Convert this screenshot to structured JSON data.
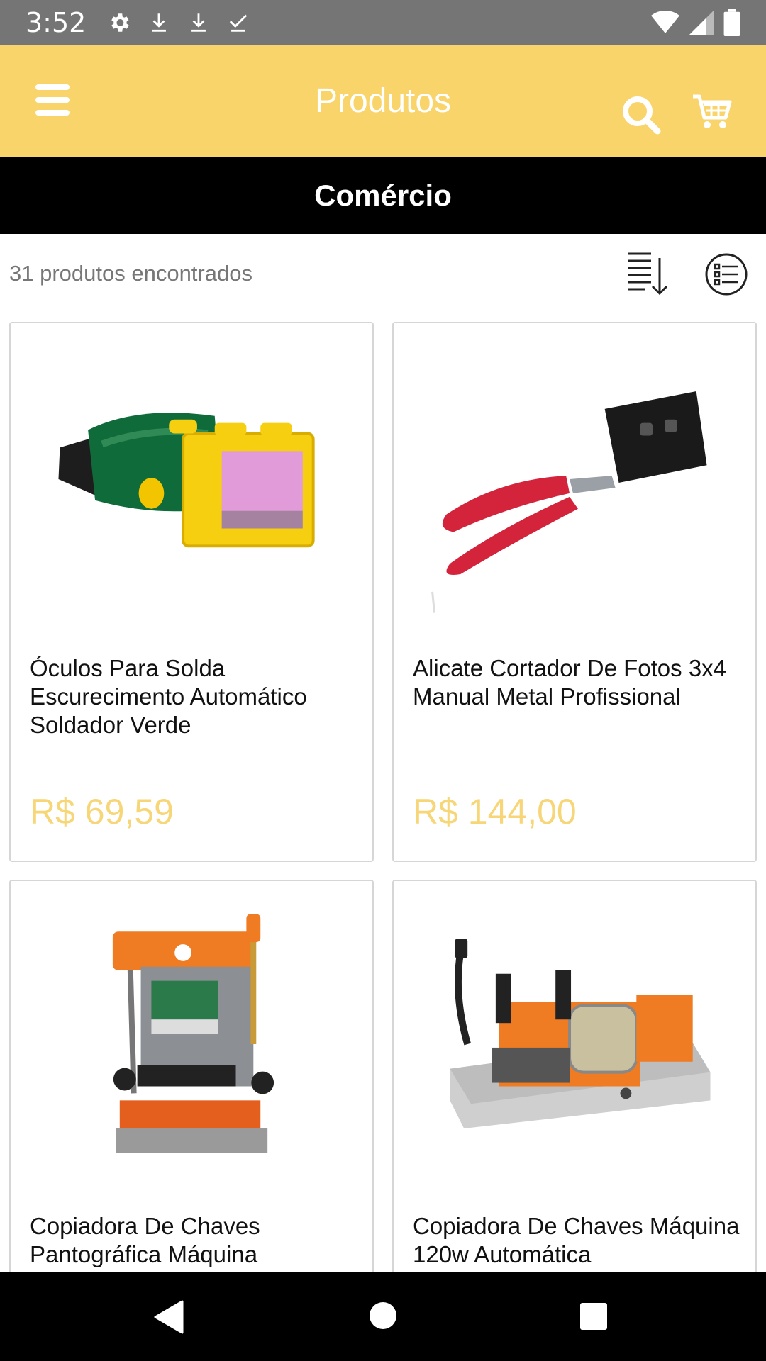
{
  "status_bar": {
    "time": "3:52",
    "left_icons": [
      "settings-icon",
      "download-icon",
      "download-icon",
      "download-done-icon"
    ],
    "right_icons": [
      "wifi-icon",
      "signal-icon",
      "battery-icon"
    ]
  },
  "app_bar": {
    "title": "Produtos",
    "background": "#f8d46a",
    "icons": [
      "menu-icon",
      "search-icon",
      "cart-icon"
    ]
  },
  "category": {
    "label": "Comércio"
  },
  "results": {
    "count_text": "31 produtos encontrados",
    "icons": [
      "sort-icon",
      "list-view-icon"
    ]
  },
  "products": [
    {
      "name": "Óculos Para Solda Escurecimento Automático Soldador Verde",
      "price": "R$ 69,59",
      "image": "welding-goggles-image"
    },
    {
      "name": "Alicate Cortador De Fotos 3x4 Manual Metal Profissional",
      "price": "R$ 144,00",
      "image": "photo-cutter-pliers-image"
    },
    {
      "name": "Copiadora De Chaves Pantográfica Máquina",
      "price": "",
      "image": "key-cutting-machine-image"
    },
    {
      "name": "Copiadora De Chaves Máquina 120w Automática",
      "price": "",
      "image": "key-copier-machine-image"
    }
  ],
  "colors": {
    "accent": "#f8d46a",
    "price": "#f7d678",
    "status_bar": "#757575"
  },
  "nav_bar": {
    "icons": [
      "back-icon",
      "home-icon",
      "recents-icon"
    ]
  }
}
